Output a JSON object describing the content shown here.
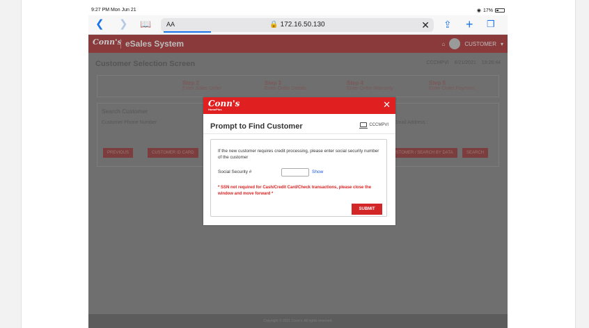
{
  "status_bar": {
    "time": "9:27 PM",
    "date": "Mon Jun 21",
    "battery": "17%"
  },
  "browser": {
    "text_size": "AA",
    "url": "172.16.50.130"
  },
  "app": {
    "logo": "Conn's",
    "title": "eSales System",
    "user": "CUSTOMER",
    "page_title": "Customer Selection Screen",
    "station": "CCCMPVI",
    "date": "6/21/2021",
    "time": "19:26:44",
    "steps": [
      {
        "label": "Step 2",
        "sub": "Enter Sales Order"
      },
      {
        "label": "Step 3",
        "sub": "Enter Order Details"
      },
      {
        "label": "Step 4",
        "sub": "Enter Order Warranty"
      },
      {
        "label": "Step 5",
        "sub": "Enter Order Payment"
      }
    ],
    "search_customer": "Search Customer",
    "phone_label": "Customer Phone Number",
    "email_label": "Email Address :",
    "buttons": {
      "previous": "PREVIOUS",
      "customer_id": "CUSTOMER ID CARD",
      "phone_search": "CUSTOMER / SEARCH BY DATA",
      "search": "SEARCH"
    },
    "footer": "Copyright © 2021 Conn's. All rights reserved."
  },
  "modal": {
    "logo": "Conn's",
    "logo_sub": "HomePlus",
    "title": "Prompt to Find Customer",
    "station": "CCCMPVI",
    "description": "If the new customer requires credit processing, please enter social security number of the customer",
    "ssn_label": "Social Security #",
    "ssn_value": "",
    "show_label": "Show",
    "note": "* SSN not required for Cash/Credit Card/Check transactions, please close the window and move forward *",
    "submit_label": "SUBMIT"
  },
  "colors": {
    "brand_red": "#e02020",
    "link_blue": "#1a55d6",
    "safari_blue": "#1a73e8"
  }
}
